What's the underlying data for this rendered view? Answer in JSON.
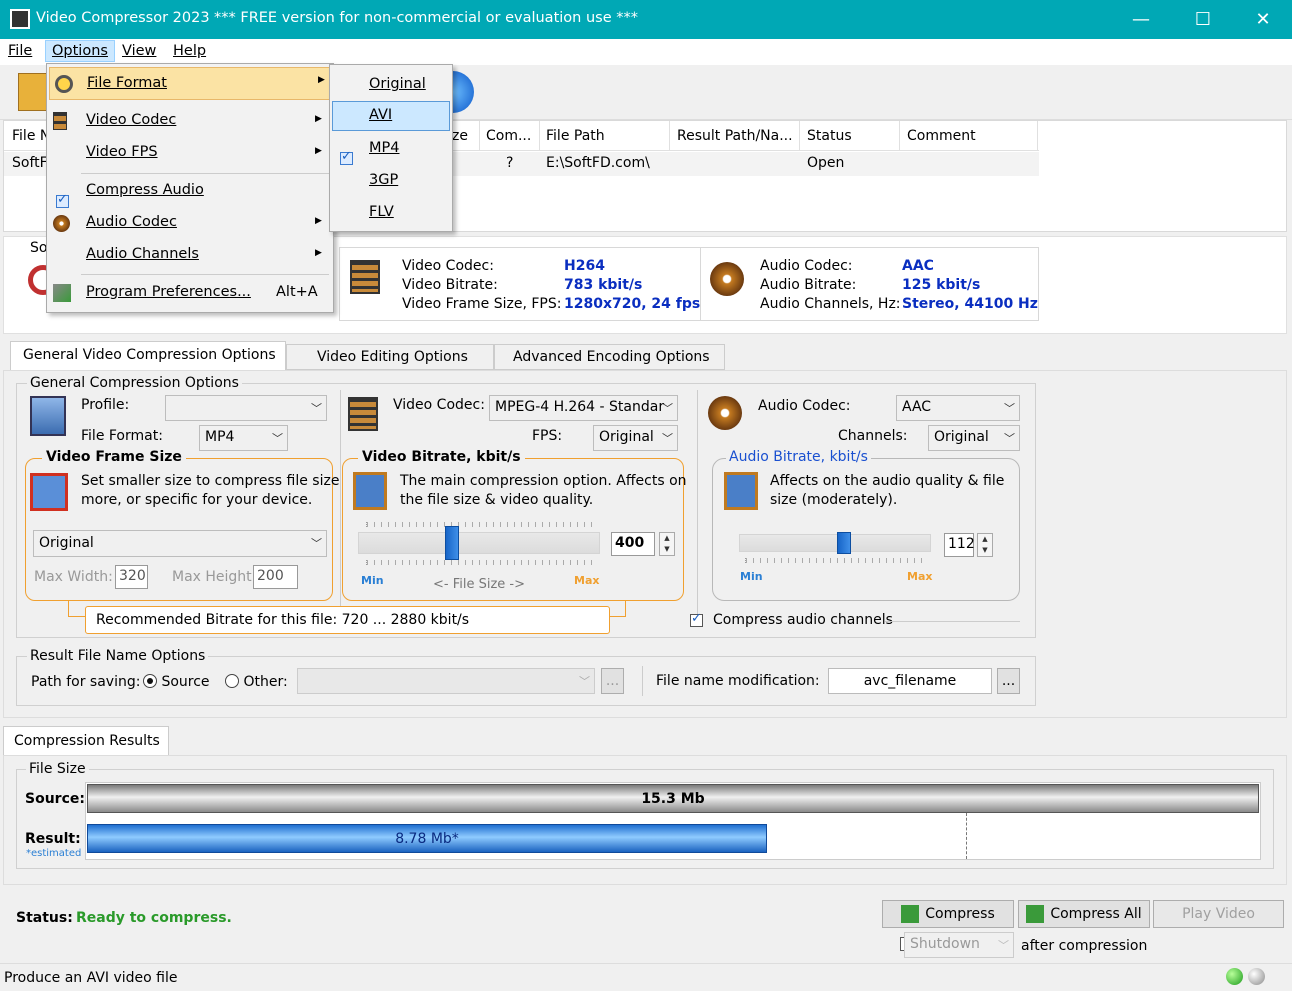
{
  "window": {
    "title": "Video Compressor 2023",
    "notice": "*** FREE version for non-commercial or evaluation use ***"
  },
  "menubar": {
    "file": "File",
    "options": "Options",
    "view": "View",
    "help": "Help"
  },
  "options_menu": {
    "items": [
      "File Format",
      "Video Codec",
      "Video FPS",
      "Compress Audio",
      "Audio Codec",
      "Audio Channels",
      "Program Preferences..."
    ],
    "shortcut": "Alt+A",
    "compress_audio_checked": true
  },
  "file_format_submenu": {
    "items": [
      "Original",
      "AVI",
      "MP4",
      "3GP",
      "FLV"
    ],
    "highlighted": "AVI",
    "checked": "MP4"
  },
  "file_list": {
    "columns": [
      "File N",
      "ze",
      "Com...",
      "File Path",
      "Result Path/Na...",
      "Status",
      "Comment"
    ],
    "row": {
      "name": "SoftF",
      "com": "?",
      "path": "E:\\SoftFD.com\\",
      "status": "Open"
    }
  },
  "source_info": {
    "label": "So",
    "video": {
      "codec_label": "Video Codec:",
      "codec": "H264",
      "bitrate_label": "Video Bitrate:",
      "bitrate": "783 kbit/s",
      "frame_label": "Video Frame Size, FPS:",
      "frame": "1280x720, 24 fps"
    },
    "audio": {
      "codec_label": "Audio Codec:",
      "codec": "AAC",
      "bitrate_label": "Audio Bitrate:",
      "bitrate": "125 kbit/s",
      "channels_label": "Audio Channels, Hz:",
      "channels": "Stereo, 44100 Hz"
    }
  },
  "tabs": [
    "General Video Compression Options",
    "Video Editing Options",
    "Advanced Encoding Options"
  ],
  "general": {
    "title": "General Compression Options",
    "profile_label": "Profile:",
    "profile_value": "",
    "file_format_label": "File Format:",
    "file_format_value": "MP4",
    "video_codec_label": "Video Codec:",
    "video_codec_value": "MPEG-4 H.264 - Standar",
    "fps_label": "FPS:",
    "fps_value": "Original",
    "audio_codec_label": "Audio Codec:",
    "audio_codec_value": "AAC",
    "channels_label": "Channels:",
    "channels_value": "Original"
  },
  "frame_size": {
    "title": "Video Frame Size",
    "desc1": "Set smaller size to compress file size",
    "desc2": "more, or specific for your device.",
    "value": "Original",
    "max_width_label": "Max Width:",
    "max_width": "320",
    "max_height_label": "Max Height:",
    "max_height": "200"
  },
  "video_bitrate": {
    "title": "Video Bitrate, kbit/s",
    "desc1": "The main compression option. Affects on",
    "desc2": "the file size & video quality.",
    "value": "400",
    "min": "Min",
    "max": "Max",
    "file_size": "<-  File Size  ->",
    "level": 0.38
  },
  "audio_bitrate": {
    "title": "Audio Bitrate, kbit/s",
    "desc1": "Affects on the audio quality & file",
    "desc2": "size (moderately).",
    "value": "112",
    "min": "Min",
    "max": "Max",
    "level": 0.55
  },
  "recommended": "Recommended Bitrate for this file: 720 ... 2880 kbit/s",
  "compress_audio_channels": "Compress audio channels",
  "result_name": {
    "title": "Result File Name Options",
    "path_label": "Path for saving:",
    "source": "Source",
    "other": "Other:",
    "modification_label": "File name modification:",
    "modification_value": "avc_filename",
    "dots": "..."
  },
  "results": {
    "tab": "Compression Results",
    "group": "File Size",
    "source_label": "Source:",
    "source_value": "15.3 Mb",
    "result_label": "Result:",
    "estimated": "*estimated",
    "result_value": "8.78 Mb*",
    "ratio": 0.58
  },
  "status": {
    "label": "Status:",
    "value": "Ready to compress."
  },
  "buttons": {
    "compress": "Compress",
    "compress_all": "Compress All",
    "play": "Play Video",
    "shutdown": "Shutdown",
    "after": "after compression"
  },
  "statusbar": "Produce an AVI video file",
  "colors": {
    "titlebar": "#00a8b5",
    "accent_blue": "#0a2ec0",
    "orange": "#f0a030",
    "green": "#2a9a2a"
  }
}
